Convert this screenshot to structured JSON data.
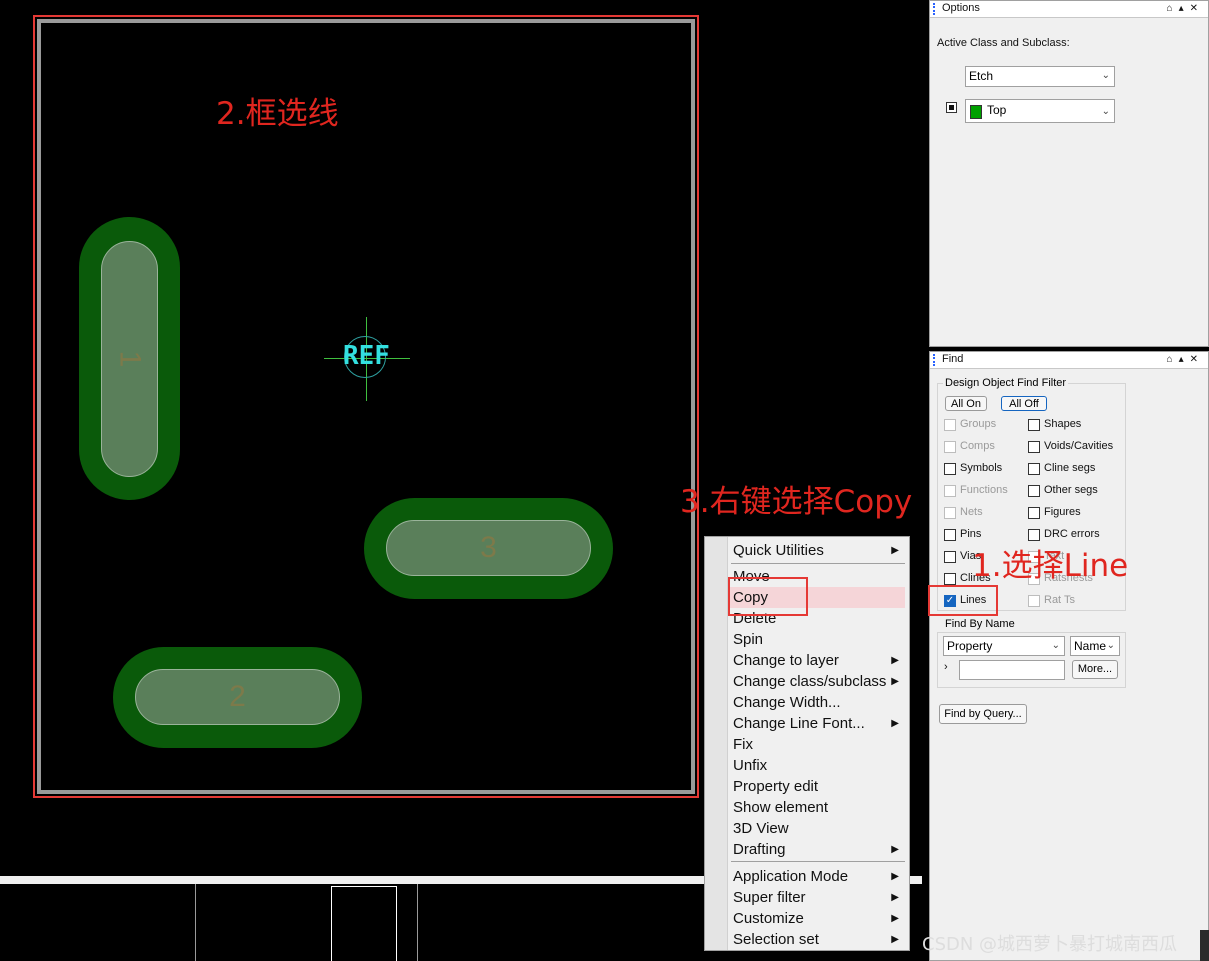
{
  "canvas": {
    "annotations": {
      "step2": "2.框选线",
      "step3": "3.右键选择Copy",
      "step1": "1.选择Line"
    },
    "ref_label": "REF",
    "pads": [
      "1",
      "3",
      "2"
    ]
  },
  "context_menu": {
    "items": [
      {
        "label": "Quick Utilities",
        "submenu": true
      },
      {
        "label": "Move",
        "submenu": false
      },
      {
        "label": "Copy",
        "submenu": false,
        "highlighted": true
      },
      {
        "label": "Delete",
        "submenu": false
      },
      {
        "label": "Spin",
        "submenu": false
      },
      {
        "label": "Change to layer",
        "submenu": true
      },
      {
        "label": "Change class/subclass",
        "submenu": true
      },
      {
        "label": "Change Width...",
        "submenu": false
      },
      {
        "label": "Change Line Font...",
        "submenu": true
      },
      {
        "label": "Fix",
        "submenu": false
      },
      {
        "label": "Unfix",
        "submenu": false
      },
      {
        "label": "Property edit",
        "submenu": false
      },
      {
        "label": "Show element",
        "submenu": false
      },
      {
        "label": "3D View",
        "submenu": false
      },
      {
        "label": "Drafting",
        "submenu": true
      },
      {
        "label": "Application Mode",
        "submenu": true
      },
      {
        "label": "Super filter",
        "submenu": true
      },
      {
        "label": "Customize",
        "submenu": true
      },
      {
        "label": "Selection set",
        "submenu": true
      }
    ]
  },
  "options_panel": {
    "title": "Options",
    "heading": "Active Class and Subclass:",
    "class_value": "Etch",
    "subclass_value": "Top",
    "subclass_color": "#00a000"
  },
  "find_panel": {
    "title": "Find",
    "filter_group": "Design Object Find Filter",
    "all_on": "All On",
    "all_off": "All Off",
    "left_items": [
      {
        "label": "Groups",
        "enabled": false,
        "checked": false
      },
      {
        "label": "Comps",
        "enabled": false,
        "checked": false
      },
      {
        "label": "Symbols",
        "enabled": true,
        "checked": false
      },
      {
        "label": "Functions",
        "enabled": false,
        "checked": false
      },
      {
        "label": "Nets",
        "enabled": false,
        "checked": false
      },
      {
        "label": "Pins",
        "enabled": true,
        "checked": false
      },
      {
        "label": "Vias",
        "enabled": true,
        "checked": false
      },
      {
        "label": "Clines",
        "enabled": true,
        "checked": false
      },
      {
        "label": "Lines",
        "enabled": true,
        "checked": true
      }
    ],
    "right_items": [
      {
        "label": "Shapes",
        "enabled": true,
        "checked": false
      },
      {
        "label": "Voids/Cavities",
        "enabled": true,
        "checked": false
      },
      {
        "label": "Cline segs",
        "enabled": true,
        "checked": false
      },
      {
        "label": "Other segs",
        "enabled": true,
        "checked": false
      },
      {
        "label": "Figures",
        "enabled": true,
        "checked": false
      },
      {
        "label": "DRC errors",
        "enabled": true,
        "checked": false
      },
      {
        "label": "Text",
        "enabled": false,
        "checked": false
      },
      {
        "label": "Ratsnests",
        "enabled": false,
        "checked": false
      },
      {
        "label": "Rat Ts",
        "enabled": false,
        "checked": false
      }
    ],
    "find_by_name_group": "Find By Name",
    "property_value": "Property",
    "name_value": "Name",
    "name_input_value": "",
    "more_button": "More...",
    "find_by_query_button": "Find by Query..."
  },
  "watermark": "CSDN @城西萝卜暴打城南西瓜"
}
